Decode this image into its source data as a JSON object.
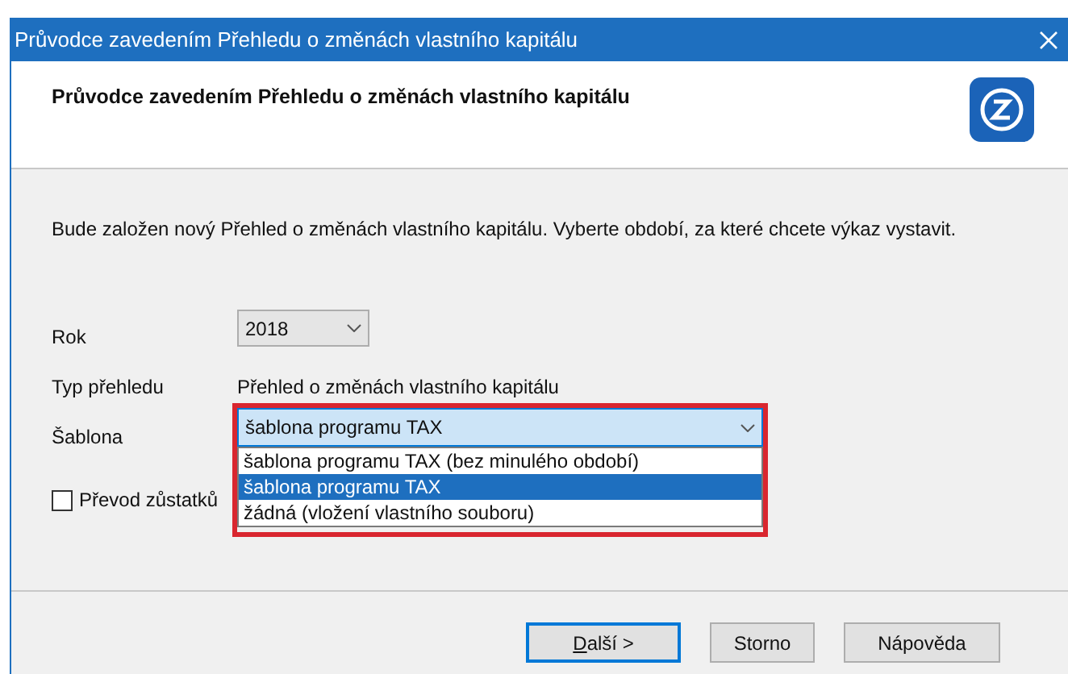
{
  "window": {
    "title": "Průvodce zavedením Přehledu o změnách vlastního kapitálu"
  },
  "header": {
    "title": "Průvodce zavedením Přehledu o změnách vlastního kapitálu"
  },
  "intro": "Bude založen nový Přehled o změnách vlastního kapitálu. Vyberte období, za které chcete výkaz vystavit.",
  "year": {
    "label": "Rok",
    "value": "2018"
  },
  "type": {
    "label": "Typ přehledu",
    "value": "Přehled o změnách vlastního kapitálu"
  },
  "template": {
    "label": "Šablona",
    "value": "šablona programu TAX",
    "expanded": true,
    "highlighted": true,
    "options": [
      {
        "label": "šablona programu TAX (bez minulého období)",
        "selected": false
      },
      {
        "label": "šablona programu TAX",
        "selected": true
      },
      {
        "label": "žádná (vložení vlastního souboru)",
        "selected": false
      }
    ]
  },
  "transfer": {
    "label": "Převod zůstatků",
    "checked": false
  },
  "buttons": [
    {
      "label": "Další >",
      "default": true,
      "underline_first": true
    },
    {
      "label": "Storno",
      "default": false,
      "underline_first": false
    },
    {
      "label": "Nápověda",
      "default": false,
      "underline_first": false
    }
  ]
}
